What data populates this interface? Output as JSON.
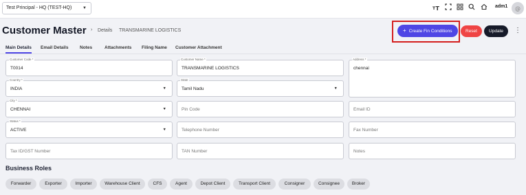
{
  "topbar": {
    "principal_select": "Test Principal - HQ (TEST-HQ)",
    "icons": [
      "text-size-icon",
      "fullscreen-icon",
      "apps-grid-icon",
      "search-icon",
      "home-icon"
    ],
    "user_name": "adm1"
  },
  "header": {
    "title": "Customer Master",
    "breadcrumb": [
      "Details",
      "TRANSMARINE LOGISTICS"
    ],
    "buttons": {
      "create_fin": "Create Fin Conditions",
      "reset": "Reset",
      "update": "Update"
    },
    "colors": {
      "primary": "#4f46e5",
      "reset": "#ef4444",
      "update": "#161a29",
      "highlight": "#d41d1d"
    }
  },
  "tabs": [
    "Main Details",
    "Email Details",
    "Notes",
    "Attachments",
    "Filing Name",
    "Customer Attachment"
  ],
  "form": {
    "customer_code": {
      "label": "Customer Code *",
      "value": "T0014"
    },
    "customer_name": {
      "label": "Customer Name *",
      "value": "TRANSMARINE LOGISTICS"
    },
    "address": {
      "label": "Address *",
      "value": "chennai"
    },
    "country": {
      "label": "Country *",
      "value": "INDIA"
    },
    "state": {
      "label": "State",
      "value": "Tamil Nadu"
    },
    "city": {
      "label": "City *",
      "value": "CHENNAI"
    },
    "pin_code": {
      "placeholder": "Pin Code"
    },
    "email_id": {
      "placeholder": "Email ID"
    },
    "status": {
      "label": "Status *",
      "value": "ACTIVE"
    },
    "telephone": {
      "placeholder": "Telephone Number"
    },
    "fax": {
      "placeholder": "Fax Number"
    },
    "tax_id": {
      "placeholder": "Tax ID/GST Number"
    },
    "tan": {
      "placeholder": "TAN Number"
    },
    "notes": {
      "placeholder": "Notes"
    }
  },
  "business_roles": {
    "title": "Business Roles",
    "chips": [
      "Forwarder",
      "Exporter",
      "Importer",
      "Warehouse Client",
      "CFS",
      "Agent",
      "Depot Client",
      "Transport Client",
      "Consigner",
      "Consignee",
      "Broker"
    ]
  }
}
